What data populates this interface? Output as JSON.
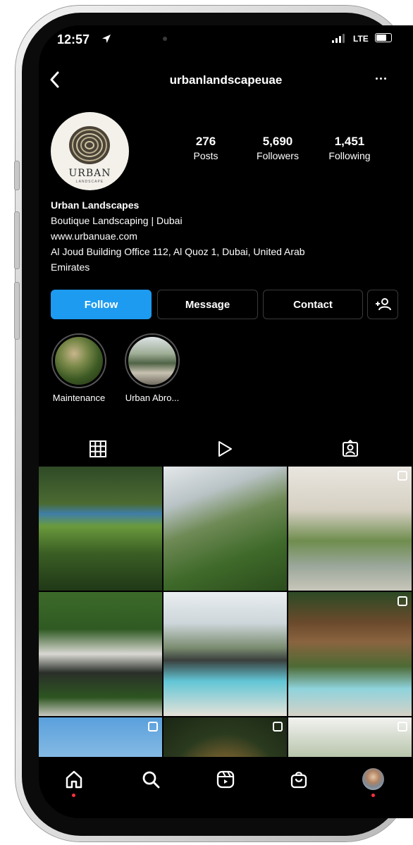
{
  "status": {
    "time": "12:57",
    "network": "LTE"
  },
  "header": {
    "username": "urbanlandscapeuae"
  },
  "profile": {
    "logo_text": "URBAN",
    "logo_subtext": "LANDSCAPE",
    "stats": [
      {
        "value": "276",
        "label": "Posts"
      },
      {
        "value": "5,690",
        "label": "Followers"
      },
      {
        "value": "1,451",
        "label": "Following"
      }
    ],
    "name": "Urban Landscapes",
    "category": "Boutique Landscaping | Dubai",
    "website": "www.urbanuae.com",
    "address_line1": "Al Joud Building Office 112, Al Quoz 1, Dubai, United Arab",
    "address_line2": "Emirates"
  },
  "actions": {
    "follow": "Follow",
    "message": "Message",
    "contact": "Contact"
  },
  "highlights": [
    {
      "label": "Maintenance"
    },
    {
      "label": "Urban Abro..."
    }
  ],
  "tabs": [
    "grid-icon",
    "reels-icon",
    "tagged-icon"
  ],
  "bottom_nav": [
    "home-icon",
    "search-icon",
    "reels-icon",
    "shop-icon",
    "profile-avatar"
  ],
  "colors": {
    "accent": "#1d9bf0",
    "background": "#000000",
    "notification": "#ff3040"
  }
}
